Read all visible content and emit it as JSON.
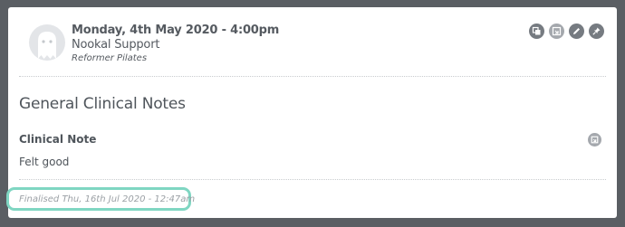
{
  "appointment": {
    "date_time": "Monday, 4th May 2020 - 4:00pm",
    "practitioner": "Nookal Support",
    "type": "Reformer Pilates"
  },
  "actions": [
    {
      "icon": "copy-icon"
    },
    {
      "icon": "print-icon"
    },
    {
      "icon": "edit-icon"
    },
    {
      "icon": "pin-icon"
    }
  ],
  "note": {
    "section_title": "General Clinical Notes",
    "field_label": "Clinical Note",
    "field_value": "Felt good",
    "finalised": "Finalised Thu, 16th Jul 2020 - 12:47am"
  },
  "colors": {
    "background": "#5a5e63",
    "card": "#ffffff",
    "text": "#4f555b",
    "icon_dark": "#767b81",
    "icon_light": "#a4a8ad",
    "highlight": "#7fd6c2"
  }
}
